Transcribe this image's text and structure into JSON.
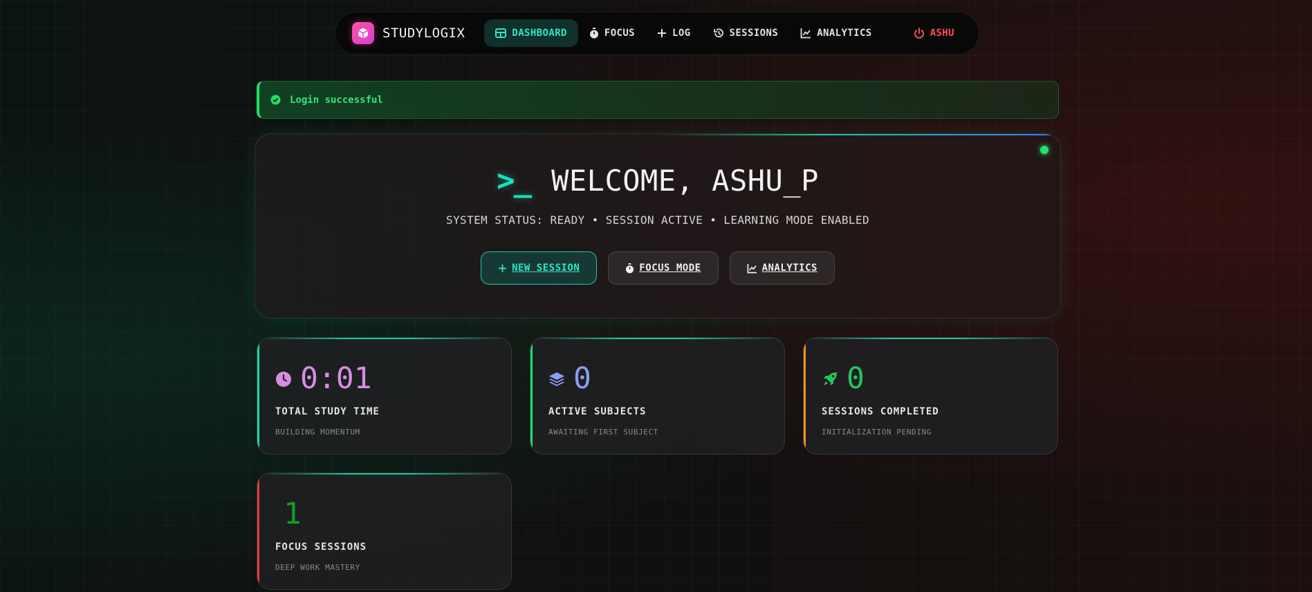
{
  "nav": {
    "brand": "STUDYLOGIX",
    "items": [
      {
        "label": "DASHBOARD",
        "icon": "dashboard-icon"
      },
      {
        "label": "FOCUS",
        "icon": "stopwatch-icon"
      },
      {
        "label": "LOG",
        "icon": "plus-icon"
      },
      {
        "label": "SESSIONS",
        "icon": "history-icon"
      },
      {
        "label": "ANALYTICS",
        "icon": "chart-line-icon"
      }
    ],
    "user": "ASHU",
    "active": "DASHBOARD"
  },
  "toast": {
    "message": "Login successful",
    "icon": "check-circle-icon"
  },
  "welcome": {
    "prompt": ">_",
    "title": "WELCOME, ASHU_P",
    "status": "SYSTEM STATUS: READY • SESSION ACTIVE • LEARNING MODE ENABLED",
    "actions": [
      {
        "label": " NEW SESSION",
        "icon": "plus-icon"
      },
      {
        "label": " FOCUS MODE",
        "icon": "stopwatch-icon"
      },
      {
        "label": " ANALYTICS",
        "icon": "chart-line-icon"
      }
    ]
  },
  "stats": [
    {
      "value": "0:01",
      "label": "TOTAL STUDY TIME",
      "desc": "BUILDING MOMENTUM",
      "icon": "clock-icon",
      "color": "#d88de0",
      "accent": "#1fd6a6"
    },
    {
      "value": "0",
      "label": "ACTIVE SUBJECTS",
      "desc": "AWAITING FIRST SUBJECT",
      "icon": "layers-icon",
      "color": "#8f9df0",
      "accent": "#1ee06a"
    },
    {
      "value": "0",
      "label": "SESSIONS COMPLETED",
      "desc": "INITIALIZATION PENDING",
      "icon": "rocket-icon",
      "color": "#22c55e",
      "accent": "#f5921f"
    },
    {
      "value": "1",
      "label": "FOCUS SESSIONS",
      "desc": "DEEP WORK MASTERY",
      "icon": "",
      "color": "#159a2e",
      "accent": "#e53b3b"
    }
  ],
  "colors": {
    "accent": "#19e0bb",
    "success": "#22e06b",
    "danger": "#ff4d5a",
    "brand": "#ff4fa3"
  }
}
